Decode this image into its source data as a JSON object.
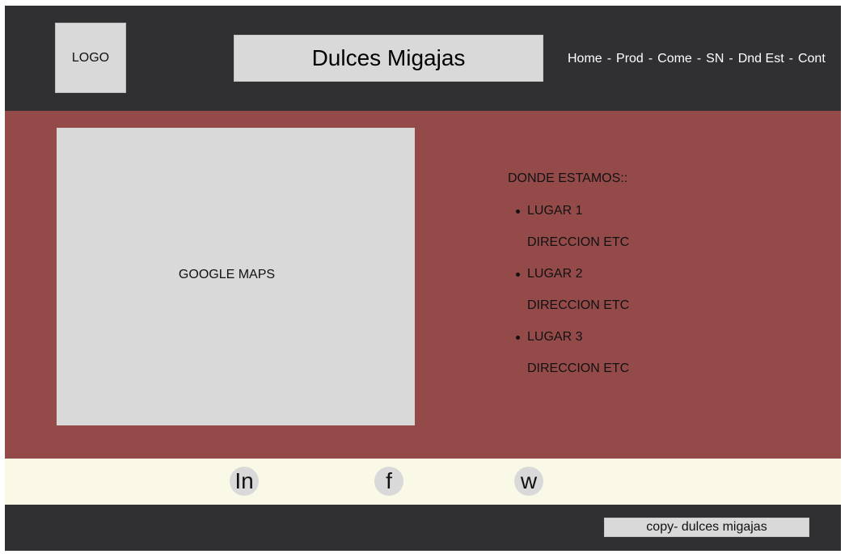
{
  "header": {
    "logo_label": "LOGO",
    "site_title": "Dulces Migajas",
    "nav": [
      {
        "label": "Home"
      },
      {
        "label": "Prod"
      },
      {
        "label": "Come"
      },
      {
        "label": "SN"
      },
      {
        "label": "Dnd Est"
      },
      {
        "label": "Cont"
      }
    ],
    "nav_separator": "-"
  },
  "main": {
    "map_label": "GOOGLE MAPS",
    "locations_heading": "DONDE ESTAMOS::",
    "locations": [
      {
        "name": "LUGAR 1",
        "address": "DIRECCION ETC"
      },
      {
        "name": "LUGAR 2",
        "address": "DIRECCION ETC"
      },
      {
        "name": "LUGAR 3",
        "address": "DIRECCION ETC"
      }
    ]
  },
  "social": {
    "linkedin": "In",
    "facebook": "f",
    "whatsapp": "w"
  },
  "footer": {
    "copyright": "copy- dulces migajas"
  },
  "colors": {
    "header_bg": "#303033",
    "main_bg": "#954a4a",
    "social_bg": "#faf8e6",
    "placeholder_gray": "#d9d9d9"
  },
  "icons": {
    "linkedin": "linkedin-icon",
    "facebook": "facebook-icon",
    "whatsapp": "whatsapp-icon"
  }
}
